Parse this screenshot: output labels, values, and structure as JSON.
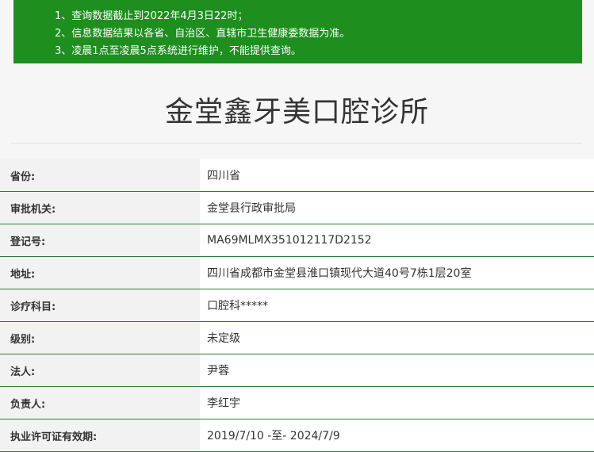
{
  "notice": {
    "items": [
      "1、查询数据截止到2022年4月3日22时；",
      "2、信息数据结果以各省、自治区、直辖市卫生健康委数据为准。",
      "3、凌晨1点至凌晨5点系统进行维护，不能提供查询。"
    ]
  },
  "title": "金堂鑫牙美口腔诊所",
  "rows": [
    {
      "label": "省份:",
      "value": "四川省"
    },
    {
      "label": "审批机关:",
      "value": "金堂县行政审批局"
    },
    {
      "label": "登记号:",
      "value": "MA69MLMX351012117D2152"
    },
    {
      "label": "地址:",
      "value": "四川省成都市金堂县淮口镇现代大道40号7栋1层20室"
    },
    {
      "label": "诊疗科目:",
      "value": "口腔科*****"
    },
    {
      "label": "级别:",
      "value": "未定级"
    },
    {
      "label": "法人:",
      "value": "尹蓉"
    },
    {
      "label": "负责人:",
      "value": "李红宇"
    },
    {
      "label": "执业许可证有效期:",
      "value": "2019/7/10 -至- 2024/7/9"
    }
  ]
}
